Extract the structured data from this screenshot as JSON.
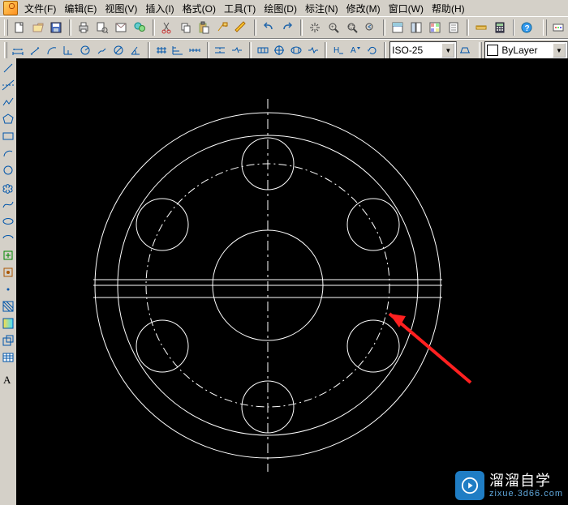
{
  "menu": {
    "file": "文件(F)",
    "edit": "编辑(E)",
    "view": "视图(V)",
    "insert": "插入(I)",
    "format": "格式(O)",
    "tool": "工具(T)",
    "draw": "绘图(D)",
    "annotate": "标注(N)",
    "modify": "修改(M)",
    "window": "窗口(W)",
    "help": "帮助(H)"
  },
  "combos": {
    "dimstyle": "ISO-25",
    "layer": "ByLayer"
  },
  "watermark": {
    "main": "溜溜自学",
    "sub": "zixue.3d66.com"
  }
}
